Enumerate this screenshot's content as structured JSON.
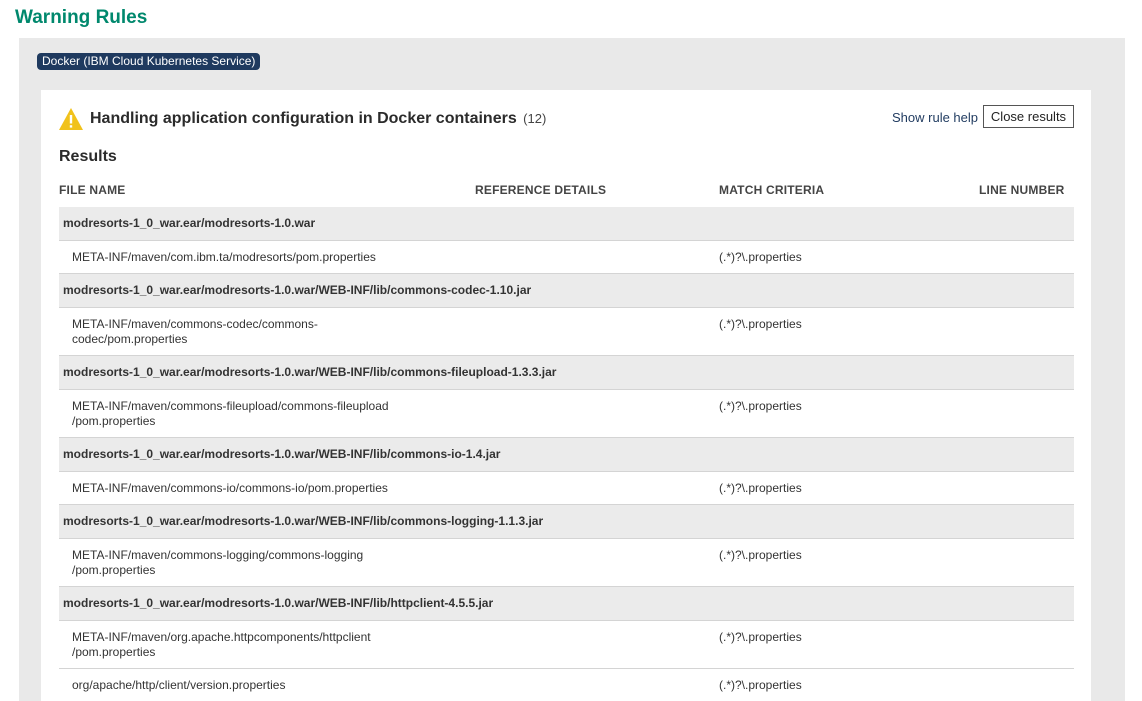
{
  "page": {
    "title": "Warning Rules"
  },
  "technology_tag": "Docker (IBM Cloud Kubernetes Service)",
  "rule": {
    "title": "Handling application configuration in Docker containers",
    "count": "(12)",
    "help_link": "Show rule help",
    "close_button": "Close results",
    "icon": "warning-triangle-icon",
    "icon_color": "#f1c21b"
  },
  "results": {
    "heading": "Results",
    "columns": [
      "FILE NAME",
      "REFERENCE DETAILS",
      "MATCH CRITERIA",
      "LINE NUMBER"
    ],
    "groups": [
      {
        "archive": "modresorts-1_0_war.ear/modresorts-1.0.war",
        "files": [
          {
            "name": "META-INF/maven/com.ibm.ta/modresorts/pom.properties",
            "match": "(.*)?\\.properties"
          }
        ]
      },
      {
        "archive": "modresorts-1_0_war.ear/modresorts-1.0.war/WEB-INF/lib/commons-codec-1.10.jar",
        "files": [
          {
            "name": "META-INF/maven/commons-codec/commons-\ncodec/pom.properties",
            "match": "(.*)?\\.properties"
          }
        ]
      },
      {
        "archive": "modresorts-1_0_war.ear/modresorts-1.0.war/WEB-INF/lib/commons-fileupload-1.3.3.jar",
        "files": [
          {
            "name": "META-INF/maven/commons-fileupload/commons-fileupload\n/pom.properties",
            "match": "(.*)?\\.properties"
          }
        ]
      },
      {
        "archive": "modresorts-1_0_war.ear/modresorts-1.0.war/WEB-INF/lib/commons-io-1.4.jar",
        "files": [
          {
            "name": "META-INF/maven/commons-io/commons-io/pom.properties",
            "match": "(.*)?\\.properties"
          }
        ]
      },
      {
        "archive": "modresorts-1_0_war.ear/modresorts-1.0.war/WEB-INF/lib/commons-logging-1.1.3.jar",
        "files": [
          {
            "name": "META-INF/maven/commons-logging/commons-logging\n/pom.properties",
            "match": "(.*)?\\.properties"
          }
        ]
      },
      {
        "archive": "modresorts-1_0_war.ear/modresorts-1.0.war/WEB-INF/lib/httpclient-4.5.5.jar",
        "files": [
          {
            "name": "META-INF/maven/org.apache.httpcomponents/httpclient\n/pom.properties",
            "match": "(.*)?\\.properties"
          },
          {
            "name": "org/apache/http/client/version.properties",
            "match": "(.*)?\\.properties"
          }
        ]
      }
    ]
  }
}
